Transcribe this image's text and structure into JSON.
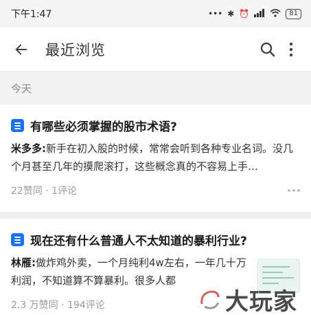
{
  "status_bar": {
    "time": "下午1:47",
    "battery": "81"
  },
  "app_bar": {
    "title": "最近浏览"
  },
  "section": {
    "label": "今天"
  },
  "items": [
    {
      "title": "有哪些必须掌握的股市术语?",
      "author": "米多多:",
      "excerpt": "新手在初入股的时候，常常会听到各种专业名词。没几个月甚至几年的摸爬滚打，这些概念真的不容易上手…",
      "stats": "22赞同 · 1评论"
    },
    {
      "title": "现在还有什么普通人不太知道的暴利行业?",
      "author": "林雁:",
      "excerpt": "做炸鸡外卖，一个月纯利4w左右，一年几十万利润，不知道算不算暴利。很多人都",
      "stats": "2.3 万赞同 · 194评论"
    }
  ],
  "watermark": {
    "text": "大玩家"
  },
  "colors": {
    "accent": "#1772f6",
    "section_bg": "#f2f2f2",
    "meta_text": "#999999"
  }
}
